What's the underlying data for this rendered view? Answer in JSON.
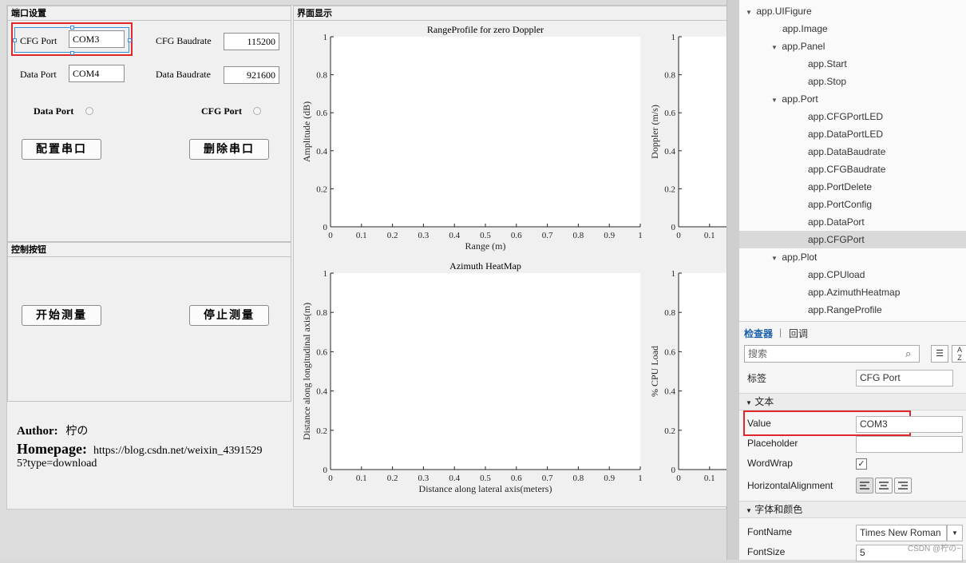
{
  "port_panel": {
    "title": "端口设置",
    "cfg_port_label": "CFG Port",
    "cfg_port_value": "COM3",
    "cfg_baud_label": "CFG Baudrate",
    "cfg_baud_value": "115200",
    "data_port_label": "Data Port",
    "data_port_value": "COM4",
    "data_baud_label": "Data Baudrate",
    "data_baud_value": "921600",
    "led_data_label": "Data Port",
    "led_cfg_label": "CFG Port",
    "config_button": "配置串口",
    "delete_button": "删除串口"
  },
  "control_panel": {
    "title": "控制按钮",
    "start_button": "开始测量",
    "stop_button": "停止测量"
  },
  "author": {
    "author_label": "Author:",
    "author_name": "柠の",
    "homepage_label": "Homepage:",
    "homepage_url_line1": "https://blog.csdn.net/weixin_4391529",
    "homepage_url_line2": "5?type=download"
  },
  "display_panel": {
    "title": "界面显示"
  },
  "chart_data": [
    {
      "type": "line",
      "title": "RangeProfile for zero Doppler",
      "xlabel": "Range (m)",
      "ylabel": "Amplitude (dB)",
      "xlim": [
        0,
        1
      ],
      "ylim": [
        0,
        1
      ],
      "xticks": [
        "0",
        "0.1",
        "0.2",
        "0.3",
        "0.4",
        "0.5",
        "0.6",
        "0.7",
        "0.8",
        "0.9",
        "1"
      ],
      "yticks": [
        "0",
        "0.2",
        "0.4",
        "0.6",
        "0.8",
        "1"
      ],
      "series": []
    },
    {
      "type": "heatmap",
      "title": "Azimuth HeatMap",
      "xlabel": "Distance along lateral axis(meters)",
      "ylabel": "Distance  along longitudinal axis(m)",
      "xlim": [
        0,
        1
      ],
      "ylim": [
        0,
        1
      ],
      "xticks": [
        "0",
        "0.1",
        "0.2",
        "0.3",
        "0.4",
        "0.5",
        "0.6",
        "0.7",
        "0.8",
        "0.9",
        "1"
      ],
      "yticks": [
        "0",
        "0.2",
        "0.4",
        "0.6",
        "0.8",
        "1"
      ],
      "series": []
    },
    {
      "type": "scatter",
      "title": "",
      "xlabel": "",
      "ylabel": "Doppler (m/s)",
      "xticks": [
        "0",
        "0.1"
      ],
      "yticks": [
        "0",
        "0.2",
        "0.4",
        "0.6",
        "0.8",
        "1"
      ],
      "series": []
    },
    {
      "type": "line",
      "title": "",
      "xlabel": "",
      "ylabel": "% CPU Load",
      "xticks": [
        "0",
        "0.1"
      ],
      "yticks": [
        "0",
        "0.2",
        "0.4",
        "0.6",
        "0.8",
        "1"
      ],
      "series": []
    }
  ],
  "tree": {
    "items": [
      {
        "label": "app.UIFigure",
        "level": 1,
        "expanded": true
      },
      {
        "label": "app.Image",
        "level": 2
      },
      {
        "label": "app.Panel",
        "level": 2,
        "expanded": true
      },
      {
        "label": "app.Start",
        "level": 3
      },
      {
        "label": "app.Stop",
        "level": 3
      },
      {
        "label": "app.Port",
        "level": 2,
        "expanded": true
      },
      {
        "label": "app.CFGPortLED",
        "level": 3
      },
      {
        "label": "app.DataPortLED",
        "level": 3
      },
      {
        "label": "app.DataBaudrate",
        "level": 3
      },
      {
        "label": "app.CFGBaudrate",
        "level": 3
      },
      {
        "label": "app.PortDelete",
        "level": 3
      },
      {
        "label": "app.PortConfig",
        "level": 3
      },
      {
        "label": "app.DataPort",
        "level": 3
      },
      {
        "label": "app.CFGPort",
        "level": 3,
        "selected": true
      },
      {
        "label": "app.Plot",
        "level": 2,
        "expanded": true
      },
      {
        "label": "app.CPUload",
        "level": 3
      },
      {
        "label": "app.AzimuthHeatmap",
        "level": 3
      },
      {
        "label": "app.RangeProfile",
        "level": 3
      }
    ]
  },
  "inspector": {
    "tab_inspector": "检查器",
    "tab_callback": "回调",
    "search_placeholder": "搜索",
    "label_name": "标签",
    "label_value": "CFG Port",
    "section_text": "文本",
    "value_name": "Value",
    "value_value": "COM3",
    "placeholder_name": "Placeholder",
    "placeholder_value": "",
    "wordwrap_name": "WordWrap",
    "wordwrap_check": "✓",
    "halign_name": "HorizontalAlignment",
    "section_font": "字体和颜色",
    "fontname_name": "FontName",
    "fontname_value": "Times New Roman",
    "fontsize_name": "FontSize",
    "fontsize_value": "5",
    "watermark": "CSDN @柠の~"
  },
  "colors": {
    "highlight_red": "#e0282b",
    "selection_blue": "#3a8fd6",
    "tab_active": "#1a5fa8"
  }
}
